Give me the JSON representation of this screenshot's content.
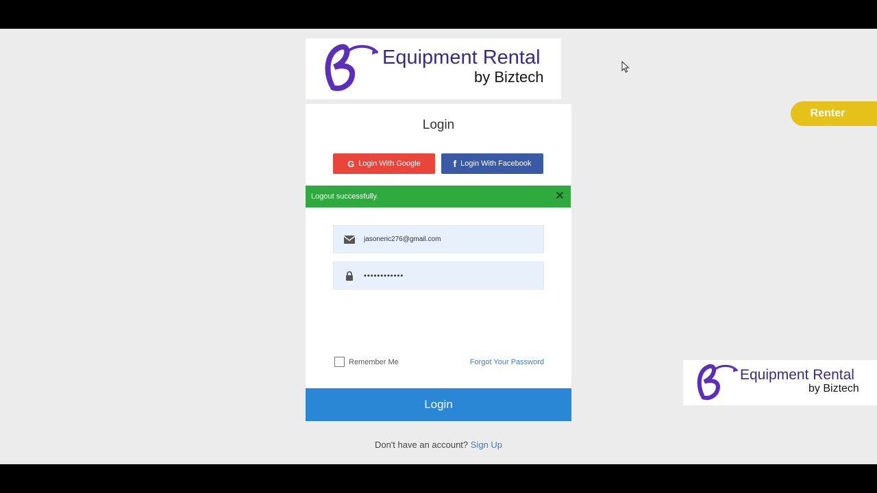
{
  "brand": {
    "title": "Equipment Rental",
    "subtitle": "by Biztech",
    "colors": {
      "purple": "#3a2a86",
      "violet": "#6a3fcf"
    }
  },
  "login": {
    "title": "Login",
    "google_label": "Login With Google",
    "facebook_label": "Login With Facebook",
    "alert_message": "Logout successfully.",
    "email_value": "jasoneric276@gmail.com",
    "password_value": "••••••••••••",
    "remember_label": "Remember Me",
    "forgot_label": "Forgot Your Password",
    "submit_label": "Login",
    "signup_prompt": "Don't have an account?",
    "signup_link": "Sign Up"
  },
  "renter_tab": {
    "label": "Renter",
    "color": "#e6c11a"
  },
  "colors": {
    "google": "#e9453a",
    "facebook": "#3b5aa6",
    "alert": "#2eaa3f",
    "primary": "#2a87d6"
  },
  "icons": [
    "google-icon",
    "facebook-icon",
    "close-icon",
    "envelope-icon",
    "lock-icon",
    "cursor-icon"
  ]
}
